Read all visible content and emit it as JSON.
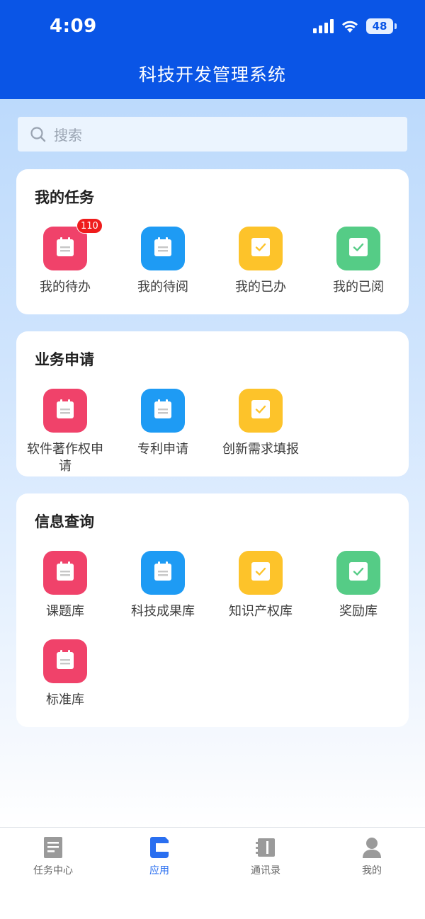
{
  "status_bar": {
    "time": "4:09",
    "battery": "48"
  },
  "header": {
    "title": "科技开发管理系统"
  },
  "search": {
    "placeholder": "搜索"
  },
  "sections": {
    "tasks": {
      "title": "我的任务",
      "items": [
        {
          "label": "我的待办",
          "icon": "calendar-icon",
          "color": "#f0426a",
          "badge": "110"
        },
        {
          "label": "我的待阅",
          "icon": "calendar-icon",
          "color": "#1e9bf4"
        },
        {
          "label": "我的已办",
          "icon": "checkbox-icon",
          "color": "#fdc32a"
        },
        {
          "label": "我的已阅",
          "icon": "checkbox-icon",
          "color": "#55cc86"
        }
      ]
    },
    "business": {
      "title": "业务申请",
      "items": [
        {
          "label": "软件著作权申请",
          "icon": "calendar-icon",
          "color": "#f0426a"
        },
        {
          "label": "专利申请",
          "icon": "calendar-icon",
          "color": "#1e9bf4"
        },
        {
          "label": "创新需求填报",
          "icon": "checkbox-icon",
          "color": "#fdc32a"
        }
      ]
    },
    "info": {
      "title": "信息查询",
      "items": [
        {
          "label": "课题库",
          "icon": "calendar-icon",
          "color": "#f0426a"
        },
        {
          "label": "科技成果库",
          "icon": "calendar-icon",
          "color": "#1e9bf4"
        },
        {
          "label": "知识产权库",
          "icon": "checkbox-icon",
          "color": "#fdc32a"
        },
        {
          "label": "奖励库",
          "icon": "checkbox-icon",
          "color": "#55cc86"
        },
        {
          "label": "标准库",
          "icon": "calendar-icon",
          "color": "#f0426a"
        }
      ]
    }
  },
  "tabbar": {
    "items": [
      {
        "label": "任务中心",
        "icon": "document-icon"
      },
      {
        "label": "应用",
        "icon": "app-icon",
        "active": true
      },
      {
        "label": "通讯录",
        "icon": "contacts-book-icon"
      },
      {
        "label": "我的",
        "icon": "person-icon"
      }
    ]
  },
  "colors": {
    "primary": "#0a55e6",
    "active_tab": "#2a6ff0",
    "badge": "#ef1c1c"
  }
}
